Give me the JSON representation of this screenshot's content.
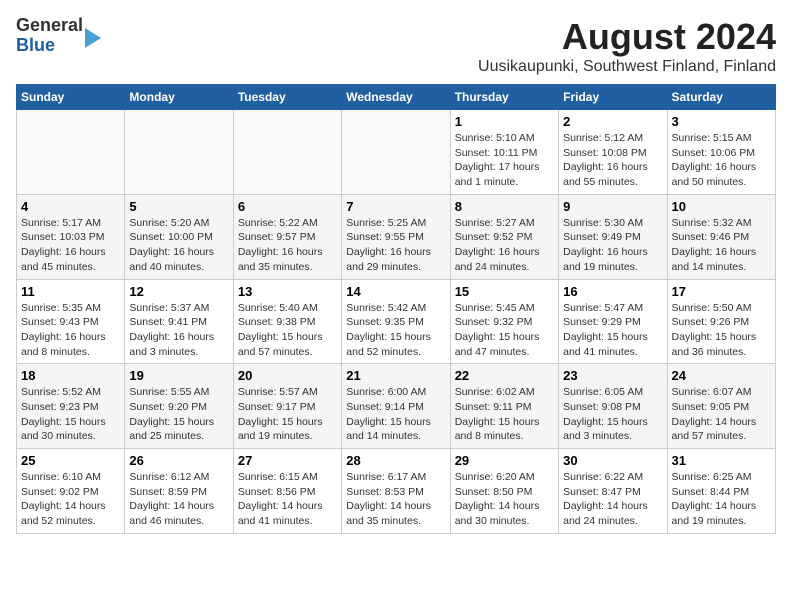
{
  "header": {
    "logo_general": "General",
    "logo_blue": "Blue",
    "title": "August 2024",
    "subtitle": "Uusikaupunki, Southwest Finland, Finland"
  },
  "calendar": {
    "weekdays": [
      "Sunday",
      "Monday",
      "Tuesday",
      "Wednesday",
      "Thursday",
      "Friday",
      "Saturday"
    ],
    "weeks": [
      [
        {
          "day": "",
          "info": ""
        },
        {
          "day": "",
          "info": ""
        },
        {
          "day": "",
          "info": ""
        },
        {
          "day": "",
          "info": ""
        },
        {
          "day": "1",
          "info": "Sunrise: 5:10 AM\nSunset: 10:11 PM\nDaylight: 17 hours and 1 minute."
        },
        {
          "day": "2",
          "info": "Sunrise: 5:12 AM\nSunset: 10:08 PM\nDaylight: 16 hours and 55 minutes."
        },
        {
          "day": "3",
          "info": "Sunrise: 5:15 AM\nSunset: 10:06 PM\nDaylight: 16 hours and 50 minutes."
        }
      ],
      [
        {
          "day": "4",
          "info": "Sunrise: 5:17 AM\nSunset: 10:03 PM\nDaylight: 16 hours and 45 minutes."
        },
        {
          "day": "5",
          "info": "Sunrise: 5:20 AM\nSunset: 10:00 PM\nDaylight: 16 hours and 40 minutes."
        },
        {
          "day": "6",
          "info": "Sunrise: 5:22 AM\nSunset: 9:57 PM\nDaylight: 16 hours and 35 minutes."
        },
        {
          "day": "7",
          "info": "Sunrise: 5:25 AM\nSunset: 9:55 PM\nDaylight: 16 hours and 29 minutes."
        },
        {
          "day": "8",
          "info": "Sunrise: 5:27 AM\nSunset: 9:52 PM\nDaylight: 16 hours and 24 minutes."
        },
        {
          "day": "9",
          "info": "Sunrise: 5:30 AM\nSunset: 9:49 PM\nDaylight: 16 hours and 19 minutes."
        },
        {
          "day": "10",
          "info": "Sunrise: 5:32 AM\nSunset: 9:46 PM\nDaylight: 16 hours and 14 minutes."
        }
      ],
      [
        {
          "day": "11",
          "info": "Sunrise: 5:35 AM\nSunset: 9:43 PM\nDaylight: 16 hours and 8 minutes."
        },
        {
          "day": "12",
          "info": "Sunrise: 5:37 AM\nSunset: 9:41 PM\nDaylight: 16 hours and 3 minutes."
        },
        {
          "day": "13",
          "info": "Sunrise: 5:40 AM\nSunset: 9:38 PM\nDaylight: 15 hours and 57 minutes."
        },
        {
          "day": "14",
          "info": "Sunrise: 5:42 AM\nSunset: 9:35 PM\nDaylight: 15 hours and 52 minutes."
        },
        {
          "day": "15",
          "info": "Sunrise: 5:45 AM\nSunset: 9:32 PM\nDaylight: 15 hours and 47 minutes."
        },
        {
          "day": "16",
          "info": "Sunrise: 5:47 AM\nSunset: 9:29 PM\nDaylight: 15 hours and 41 minutes."
        },
        {
          "day": "17",
          "info": "Sunrise: 5:50 AM\nSunset: 9:26 PM\nDaylight: 15 hours and 36 minutes."
        }
      ],
      [
        {
          "day": "18",
          "info": "Sunrise: 5:52 AM\nSunset: 9:23 PM\nDaylight: 15 hours and 30 minutes."
        },
        {
          "day": "19",
          "info": "Sunrise: 5:55 AM\nSunset: 9:20 PM\nDaylight: 15 hours and 25 minutes."
        },
        {
          "day": "20",
          "info": "Sunrise: 5:57 AM\nSunset: 9:17 PM\nDaylight: 15 hours and 19 minutes."
        },
        {
          "day": "21",
          "info": "Sunrise: 6:00 AM\nSunset: 9:14 PM\nDaylight: 15 hours and 14 minutes."
        },
        {
          "day": "22",
          "info": "Sunrise: 6:02 AM\nSunset: 9:11 PM\nDaylight: 15 hours and 8 minutes."
        },
        {
          "day": "23",
          "info": "Sunrise: 6:05 AM\nSunset: 9:08 PM\nDaylight: 15 hours and 3 minutes."
        },
        {
          "day": "24",
          "info": "Sunrise: 6:07 AM\nSunset: 9:05 PM\nDaylight: 14 hours and 57 minutes."
        }
      ],
      [
        {
          "day": "25",
          "info": "Sunrise: 6:10 AM\nSunset: 9:02 PM\nDaylight: 14 hours and 52 minutes."
        },
        {
          "day": "26",
          "info": "Sunrise: 6:12 AM\nSunset: 8:59 PM\nDaylight: 14 hours and 46 minutes."
        },
        {
          "day": "27",
          "info": "Sunrise: 6:15 AM\nSunset: 8:56 PM\nDaylight: 14 hours and 41 minutes."
        },
        {
          "day": "28",
          "info": "Sunrise: 6:17 AM\nSunset: 8:53 PM\nDaylight: 14 hours and 35 minutes."
        },
        {
          "day": "29",
          "info": "Sunrise: 6:20 AM\nSunset: 8:50 PM\nDaylight: 14 hours and 30 minutes."
        },
        {
          "day": "30",
          "info": "Sunrise: 6:22 AM\nSunset: 8:47 PM\nDaylight: 14 hours and 24 minutes."
        },
        {
          "day": "31",
          "info": "Sunrise: 6:25 AM\nSunset: 8:44 PM\nDaylight: 14 hours and 19 minutes."
        }
      ]
    ]
  }
}
